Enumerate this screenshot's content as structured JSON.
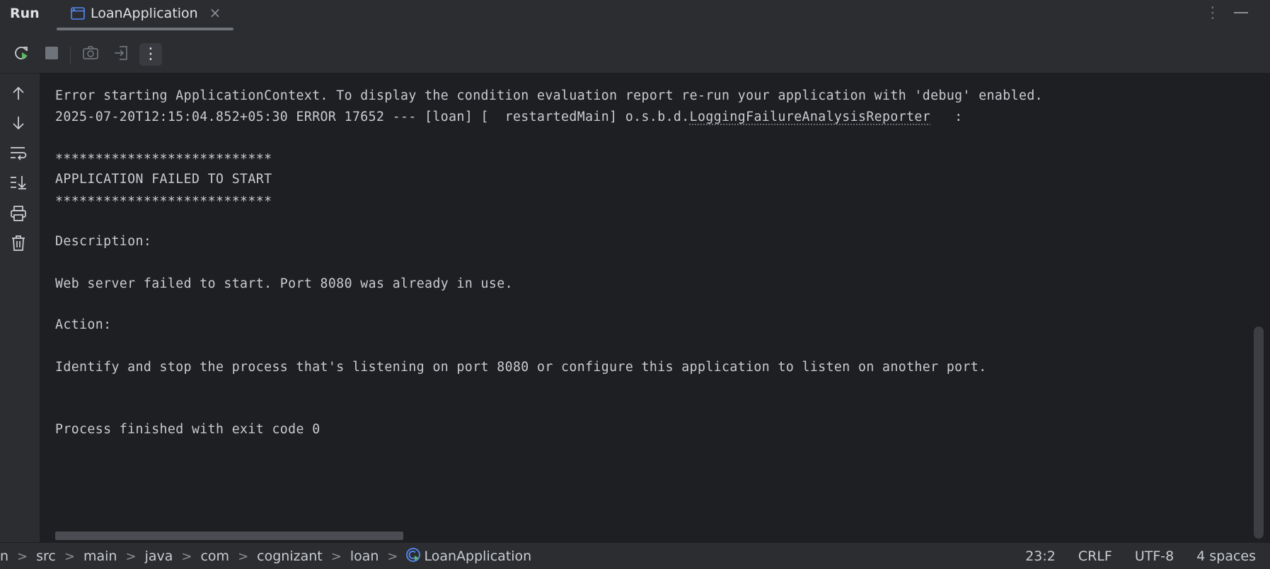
{
  "header": {
    "title": "Run",
    "tab": {
      "label": "LoanApplication",
      "close": "×"
    },
    "more_label": "⋮"
  },
  "toolbar": {
    "buttons": [
      {
        "name": "rerun-icon"
      },
      {
        "name": "stop-icon"
      },
      {
        "name": "camera-icon"
      },
      {
        "name": "exit-icon"
      },
      {
        "name": "more-vertical-icon",
        "label": "⋮"
      }
    ]
  },
  "gutter": {
    "buttons": [
      "arrow-up-icon",
      "arrow-down-icon",
      "soft-wrap-icon",
      "scroll-to-end-icon",
      "print-icon",
      "trash-icon"
    ]
  },
  "console": {
    "lines": [
      "Error starting ApplicationContext. To display the condition evaluation report re-run your application with 'debug' enabled.",
      "2025-07-20T12:15:04.852+05:30 ERROR 17652 --- [loan] [  restartedMain] o.s.b.d.",
      "LoggingFailureAnalysisReporter",
      "   :",
      "***************************",
      "APPLICATION FAILED TO START",
      "***************************",
      "Description:",
      "Web server failed to start. Port 8080 was already in use.",
      "Action:",
      "Identify and stop the process that's listening on port 8080 or configure this application to listen on another port.",
      "Process finished with exit code 0"
    ]
  },
  "statusbar": {
    "breadcrumbs": [
      "n",
      "src",
      "main",
      "java",
      "com",
      "cognizant",
      "loan",
      "LoanApplication"
    ],
    "separator": ">",
    "position": "23:2",
    "line_ending": "CRLF",
    "encoding": "UTF-8",
    "indent": "4 spaces"
  },
  "colors": {
    "background": "#1e1f22",
    "panel": "#2b2d30",
    "text": "#c9ccd1",
    "accent_blue": "#548af7",
    "run_green": "#5fb865"
  }
}
